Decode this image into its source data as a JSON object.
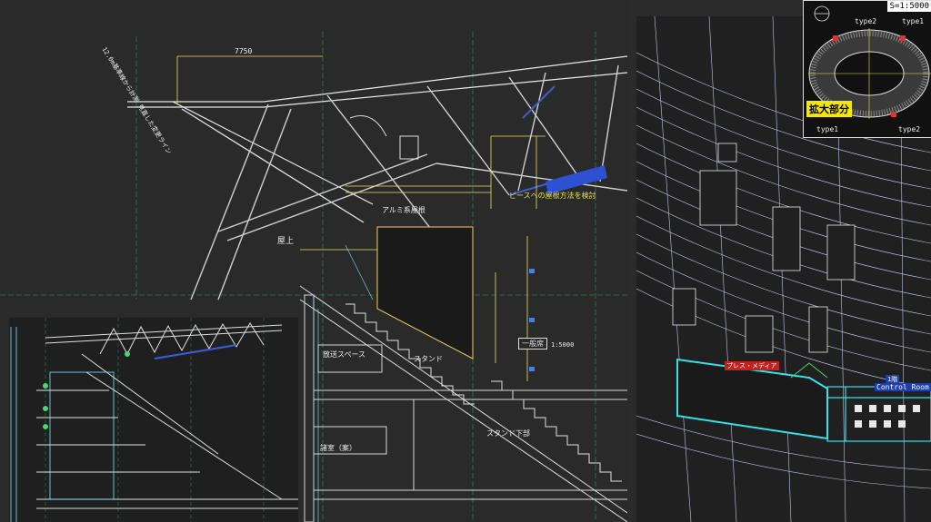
{
  "main_section": {
    "dimension_top": "7750",
    "vertical_note": "12.0m基準線から計測 見直した変更ライン",
    "level_label": "屋上",
    "room_label_1": "放送スペース",
    "room_label_2": "スタンド",
    "room_label_3": "スタンド下部",
    "room_label_4": "諸室（案）",
    "note_yellow": "ピースへの屋根方法を検討",
    "note_1": "アルミ系屋根",
    "box_label": "一般席",
    "box_value": "1:5000"
  },
  "plan_view": {
    "red_tag": "プレス・メディア",
    "b_label": "1階",
    "control_room": "Control Room"
  },
  "key_plan": {
    "scale": "S=1:5000",
    "enlarged_label": "拡大部分",
    "type_labels": [
      "type2",
      "type1",
      "type1",
      "type2"
    ]
  }
}
